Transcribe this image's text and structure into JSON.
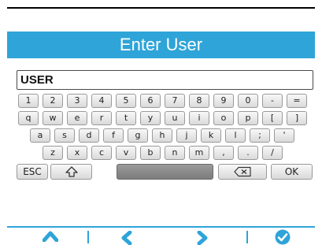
{
  "header": {
    "title": "Enter User"
  },
  "input": {
    "value": "USER"
  },
  "keyboard": {
    "row1": [
      "1",
      "2",
      "3",
      "4",
      "5",
      "6",
      "7",
      "8",
      "9",
      "0",
      "-",
      "="
    ],
    "row2": [
      "q",
      "w",
      "e",
      "r",
      "t",
      "y",
      "u",
      "i",
      "o",
      "p",
      "[",
      "]"
    ],
    "row3": [
      "a",
      "s",
      "d",
      "f",
      "g",
      "h",
      "j",
      "k",
      "l",
      ";",
      "'"
    ],
    "row4": [
      "z",
      "x",
      "c",
      "v",
      "b",
      "n",
      "m",
      ",",
      ".",
      "/"
    ],
    "bottom": {
      "esc": "ESC",
      "shift_icon": "shift-arrow-icon",
      "space": "",
      "backspace_icon": "backspace-icon",
      "ok": "OK"
    }
  },
  "nav": {
    "icons": [
      "chevron-up-icon",
      "chevron-left-icon",
      "chevron-right-icon",
      "checkmark-circle-icon"
    ]
  },
  "colors": {
    "accent": "#2ea4d8",
    "title_text": "#ffffff",
    "space_key": "#888888"
  }
}
